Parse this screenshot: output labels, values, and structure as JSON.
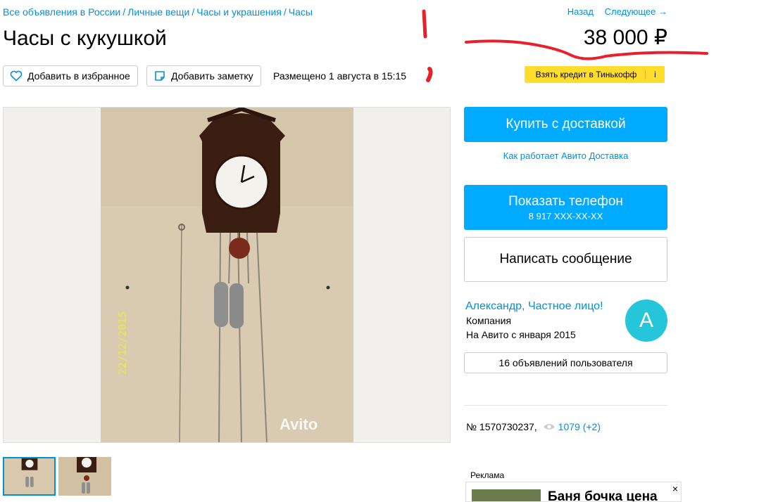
{
  "breadcrumbs": {
    "items": [
      "Все объявления в России",
      "Личные вещи",
      "Часы и украшения",
      "Часы"
    ],
    "separator": "/"
  },
  "nav": {
    "back": "Назад",
    "next": "Следующее →"
  },
  "listing": {
    "title": "Часы с кукушкой",
    "price": "38 000 ₽",
    "posted": "Размещено 1 августа в 15:15",
    "number": "№ 1570730237,",
    "views": "1079 (+2)"
  },
  "actions": {
    "favorite": "Добавить в избранное",
    "note": "Добавить заметку",
    "credit": "Взять кредит в Тинькофф",
    "credit_info": "i"
  },
  "photo": {
    "date_stamp": "22/12/2015",
    "watermark": "Avito"
  },
  "buy": {
    "button": "Купить с доставкой",
    "how_link": "Как работает Авито Доставка"
  },
  "contact": {
    "phone_label": "Показать телефон",
    "phone_number": "8 917 XXX-XX-XX",
    "message": "Написать сообщение"
  },
  "seller": {
    "name": "Александр, Частное лицо!",
    "type": "Компания",
    "since": "На Авито с января 2015",
    "avatar_letter": "A",
    "ads_count": "16 объявлений пользователя"
  },
  "ad": {
    "label": "Реклама",
    "title": "Баня бочка цена",
    "close": "×"
  },
  "colors": {
    "link": "#0091d9",
    "primary_button": "#00aaff",
    "credit_yellow": "#ffdd2d",
    "avatar": "#26c6da",
    "annotation_red": "#e8202a"
  },
  "icons": [
    "heart-icon",
    "note-icon",
    "eye-icon",
    "close-icon"
  ]
}
